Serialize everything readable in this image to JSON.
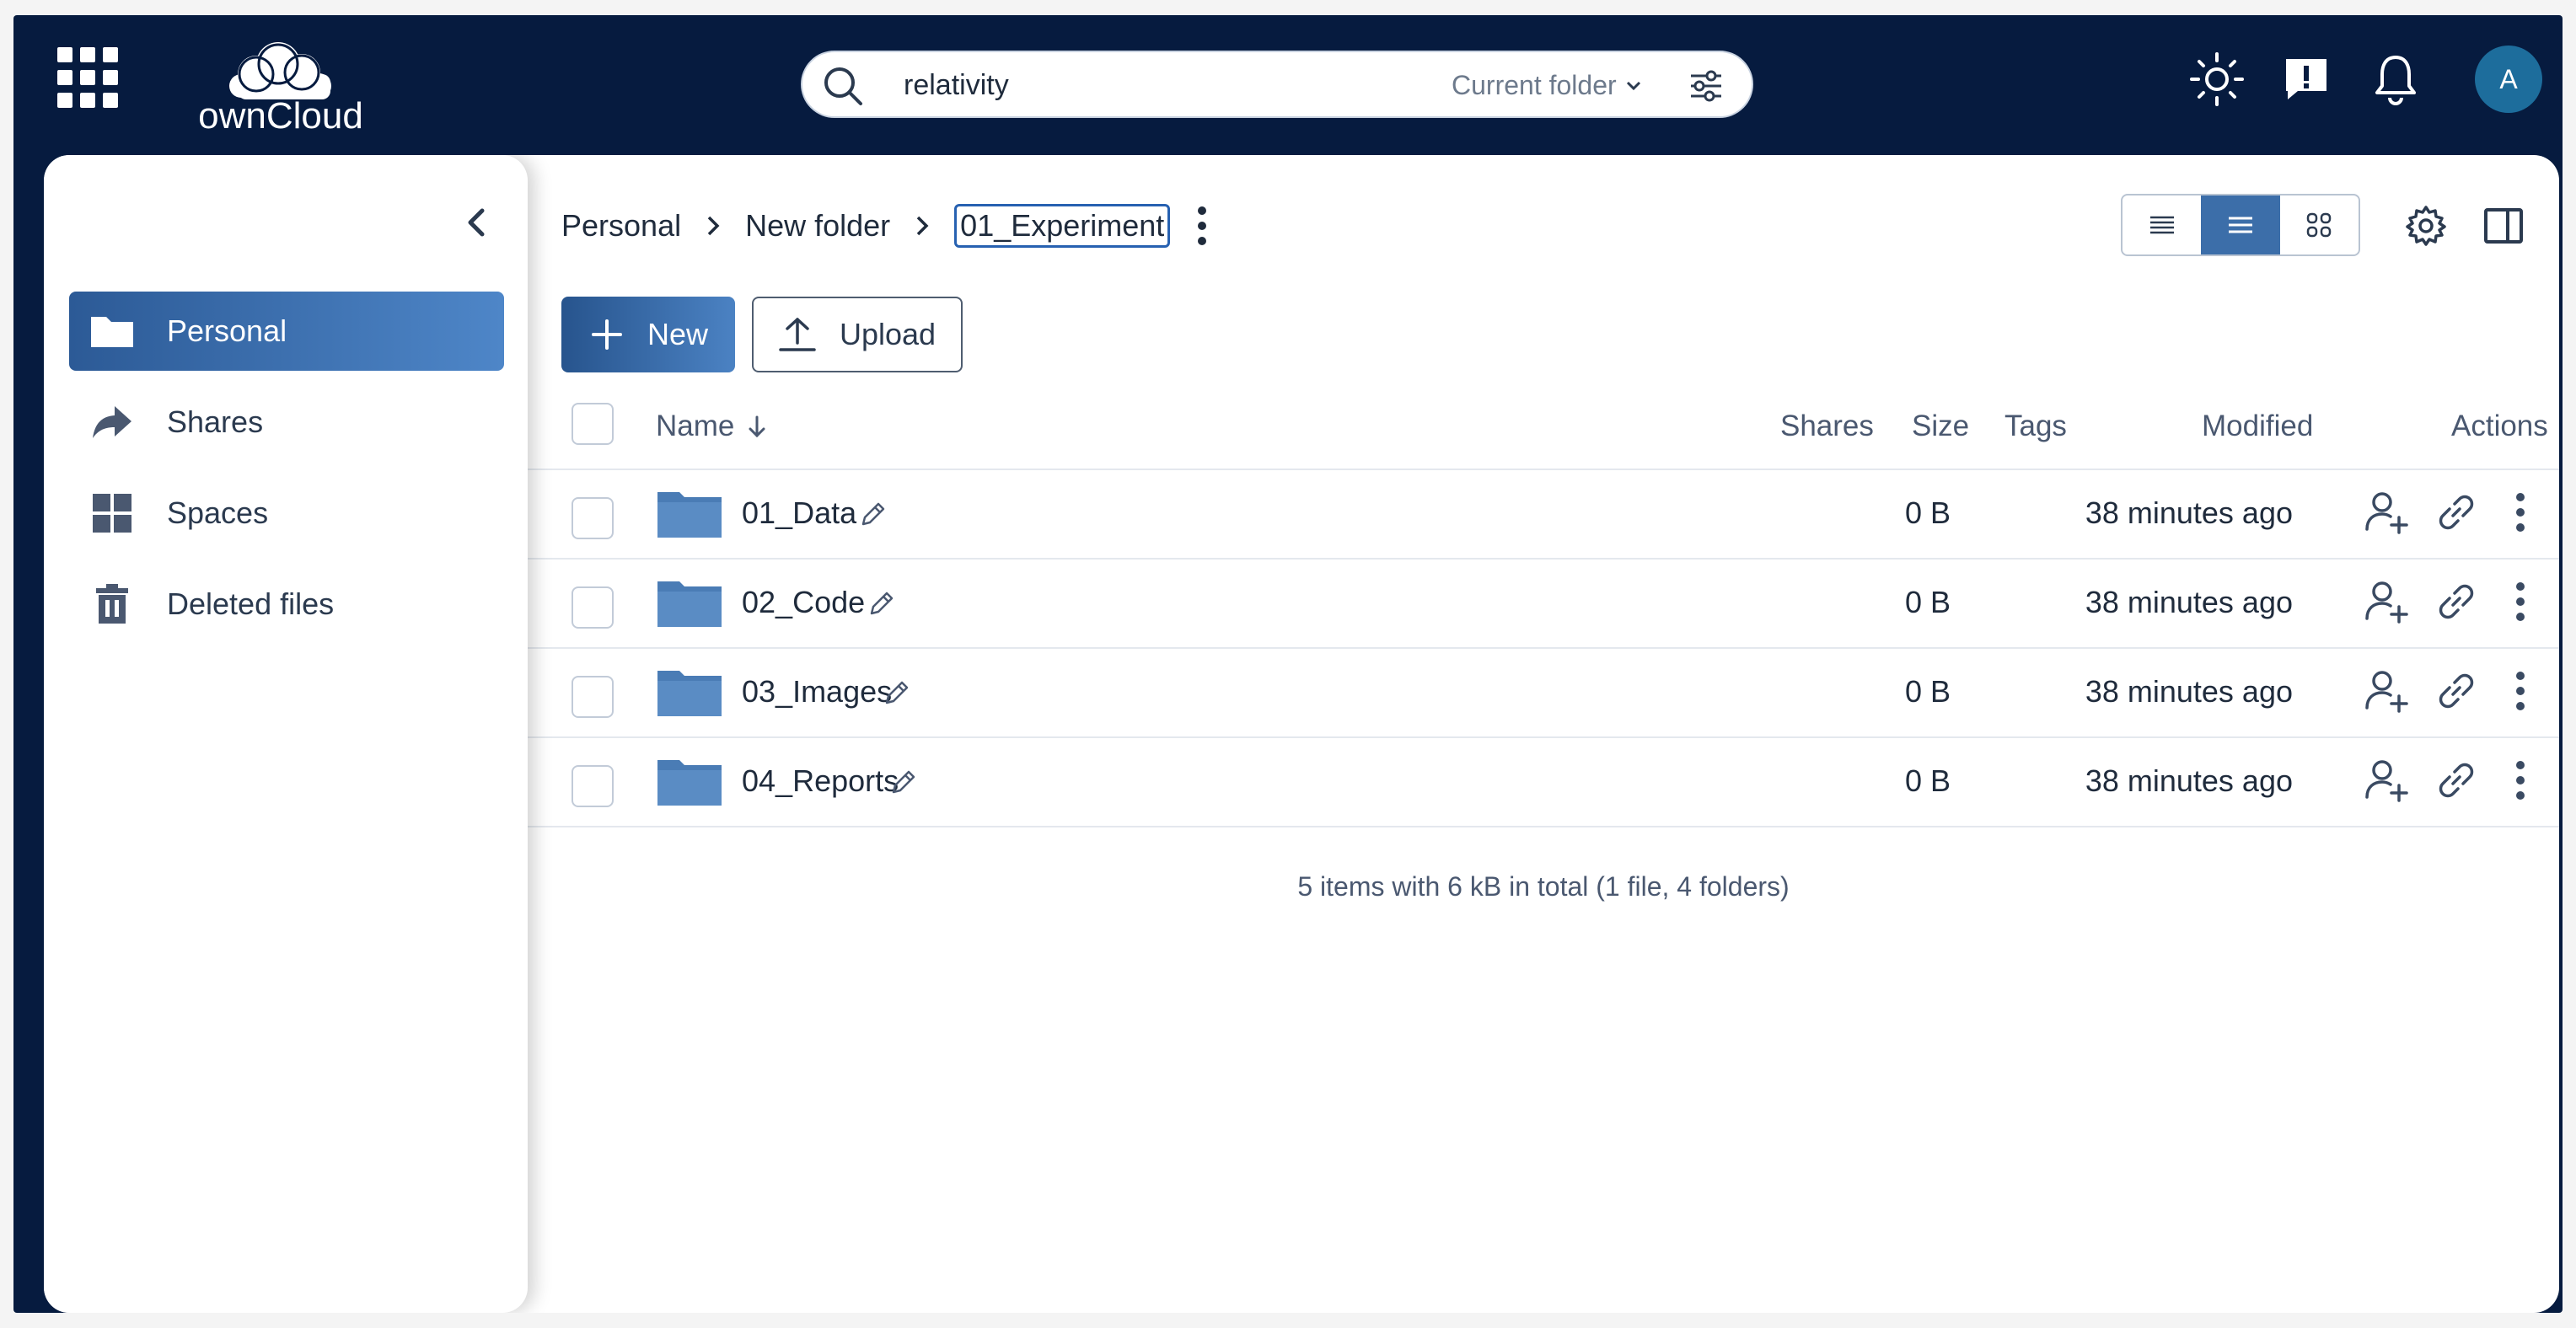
{
  "topbar": {
    "app_name": "ownCloud",
    "search": {
      "value": "relativity",
      "scope": "Current folder"
    },
    "avatar_initial": "A"
  },
  "sidebar": {
    "items": [
      {
        "label": "Personal",
        "icon": "folder-icon",
        "active": true
      },
      {
        "label": "Shares",
        "icon": "share-arrow-icon",
        "active": false
      },
      {
        "label": "Spaces",
        "icon": "grid-icon",
        "active": false
      },
      {
        "label": "Deleted files",
        "icon": "trash-icon",
        "active": false
      }
    ]
  },
  "breadcrumb": [
    "Personal",
    "New folder",
    "01_Experiment"
  ],
  "toolbar": {
    "new_label": "New",
    "upload_label": "Upload"
  },
  "table": {
    "columns": {
      "name": "Name",
      "shares": "Shares",
      "size": "Size",
      "tags": "Tags",
      "modified": "Modified",
      "actions": "Actions"
    },
    "rows": [
      {
        "name": "01_Data",
        "size": "0 B",
        "modified": "38 minutes ago"
      },
      {
        "name": "02_Code",
        "size": "0 B",
        "modified": "38 minutes ago"
      },
      {
        "name": "03_Images",
        "size": "0 B",
        "modified": "38 minutes ago"
      },
      {
        "name": "04_Reports",
        "size": "0 B",
        "modified": "38 minutes ago"
      }
    ]
  },
  "summary": "5 items with 6 kB in total (1 file, 4 folders)",
  "colors": {
    "topbar": "#061b3f",
    "accent": "#3c6ea9",
    "folder": "#4a7cb5"
  }
}
